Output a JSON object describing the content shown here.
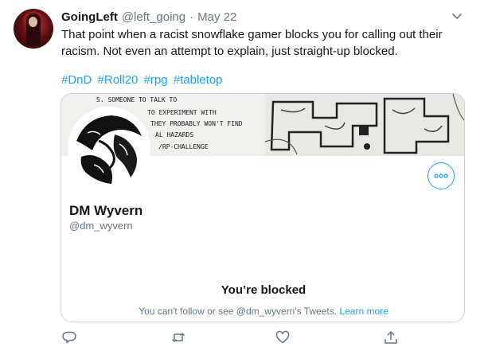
{
  "tweet": {
    "author_name": "GoingLeft",
    "author_handle": "@left_going",
    "separator": "·",
    "date": "May 22",
    "text": "That point when a racist snowflake gamer blocks you for calling out their racism. Not even an attempt to explain, just straight-up blocked.",
    "hashtags": [
      "#DnD",
      "#Roll20",
      "#rpg",
      "#tabletop"
    ]
  },
  "card": {
    "banner_lines": [
      "5. SOMEONE TO TALK TO",
      "TO EXPERIMENT WITH",
      "THEY PROBABLY WON'T FIND",
      "AL HAZARDS",
      "/RP-CHALLENGE"
    ],
    "profile_name": "DM Wyvern",
    "profile_handle": "@dm_wyvern",
    "blocked_title": "You’re blocked",
    "blocked_message": "You can't follow or see @dm_wyvern's Tweets.",
    "learn_more": "Learn more"
  },
  "icons": {
    "caret": "chevron-down-icon",
    "more": "more-icon",
    "reply": "reply-icon",
    "retweet": "retweet-icon",
    "like": "heart-icon",
    "share": "share-icon"
  },
  "colors": {
    "accent": "#1da1f2",
    "secondary_text": "#657786",
    "border": "#ccd6dd"
  }
}
